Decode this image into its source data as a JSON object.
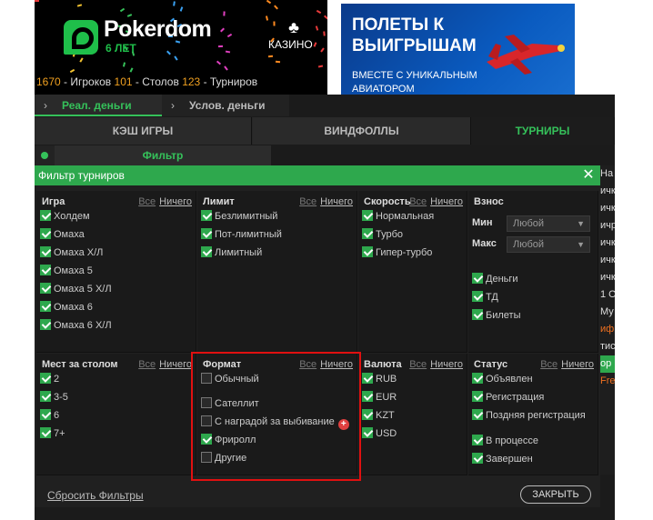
{
  "header": {
    "brand": "Pokerdom",
    "years": "6 ЛЕТ",
    "casino_label": "КАЗИНО",
    "stats": {
      "players_count": "1670",
      "players_label": "- Игроков",
      "tables_count": "101",
      "tables_label": "- Столов",
      "tournaments_count": "123",
      "tournaments_label": "- Турниров"
    }
  },
  "banner": {
    "title": "ПОЛЕТЫ К ВЫИГРЫШАМ",
    "subtitle": "ВМЕСТЕ С УНИКАЛЬНЫМ АВИАТОРОМ"
  },
  "money_tabs": {
    "real": "Реал. деньги",
    "conditional": "Услов. деньги"
  },
  "game_tabs": {
    "cash": "КЭШ ИГРЫ",
    "windfalls": "ВИНДФОЛЛЫ",
    "tournaments": "ТУРНИРЫ"
  },
  "filter_button": "Фильтр",
  "dialog": {
    "title": "Фильтр турниров",
    "all": "Все",
    "none": "Ничего",
    "game": {
      "header": "Игра",
      "options": [
        {
          "label": "Холдем",
          "checked": true
        },
        {
          "label": "Омаха",
          "checked": true
        },
        {
          "label": "Омаха Х/Л",
          "checked": true
        },
        {
          "label": "Омаха 5",
          "checked": true
        },
        {
          "label": "Омаха 5 Х/Л",
          "checked": true
        },
        {
          "label": "Омаха 6",
          "checked": true
        },
        {
          "label": "Омаха 6 Х/Л",
          "checked": true
        }
      ]
    },
    "limit": {
      "header": "Лимит",
      "options": [
        {
          "label": "Безлимитный",
          "checked": true
        },
        {
          "label": "Пот-лимитный",
          "checked": true
        },
        {
          "label": "Лимитный",
          "checked": true
        }
      ]
    },
    "speed": {
      "header": "Скорость",
      "options": [
        {
          "label": "Нормальная",
          "checked": true
        },
        {
          "label": "Турбо",
          "checked": true
        },
        {
          "label": "Гипер-турбо",
          "checked": true
        }
      ]
    },
    "buyin": {
      "header": "Взнос",
      "min_label": "Мин",
      "max_label": "Макс",
      "min_value": "Любой",
      "max_value": "Любой",
      "options": [
        {
          "label": "Деньги",
          "checked": true
        },
        {
          "label": "ТД",
          "checked": true
        },
        {
          "label": "Билеты",
          "checked": true
        }
      ]
    },
    "seats": {
      "header": "Мест за столом",
      "options": [
        {
          "label": "2",
          "checked": true
        },
        {
          "label": "3-5",
          "checked": true
        },
        {
          "label": "6",
          "checked": true
        },
        {
          "label": "7+",
          "checked": true
        }
      ]
    },
    "format": {
      "header": "Формат",
      "options": [
        {
          "label": "Обычный",
          "checked": false
        },
        {
          "label": "Сателлит",
          "checked": false
        },
        {
          "label": "С наградой за выбивание",
          "checked": false
        },
        {
          "label": "Фриролл",
          "checked": true
        },
        {
          "label": "Другие",
          "checked": false
        }
      ]
    },
    "currency": {
      "header": "Валюта",
      "options": [
        {
          "label": "RUB",
          "checked": true
        },
        {
          "label": "EUR",
          "checked": true
        },
        {
          "label": "KZT",
          "checked": true
        },
        {
          "label": "USD",
          "checked": true
        }
      ]
    },
    "status": {
      "header": "Статус",
      "options": [
        {
          "label": "Объявлен",
          "checked": true
        },
        {
          "label": "Регистрация",
          "checked": true
        },
        {
          "label": "Поздняя регистрация",
          "checked": true
        },
        {
          "label": "В процессе",
          "checked": true
        },
        {
          "label": "Завершен",
          "checked": true
        }
      ]
    },
    "reset_label": "Сбросить Фильтры",
    "close_label": "ЗАКРЫТЬ"
  },
  "side_list": [
    "На",
    "ичк",
    "ичк",
    "ичр",
    "ичк",
    "ичк",
    "ичк",
    "1 О",
    " Му",
    "ифр",
    "тис",
    "ор",
    "Fre"
  ],
  "colors": {
    "accent": "#2ea84d",
    "highlight": "#e01010",
    "stat_number": "#f0a020"
  }
}
